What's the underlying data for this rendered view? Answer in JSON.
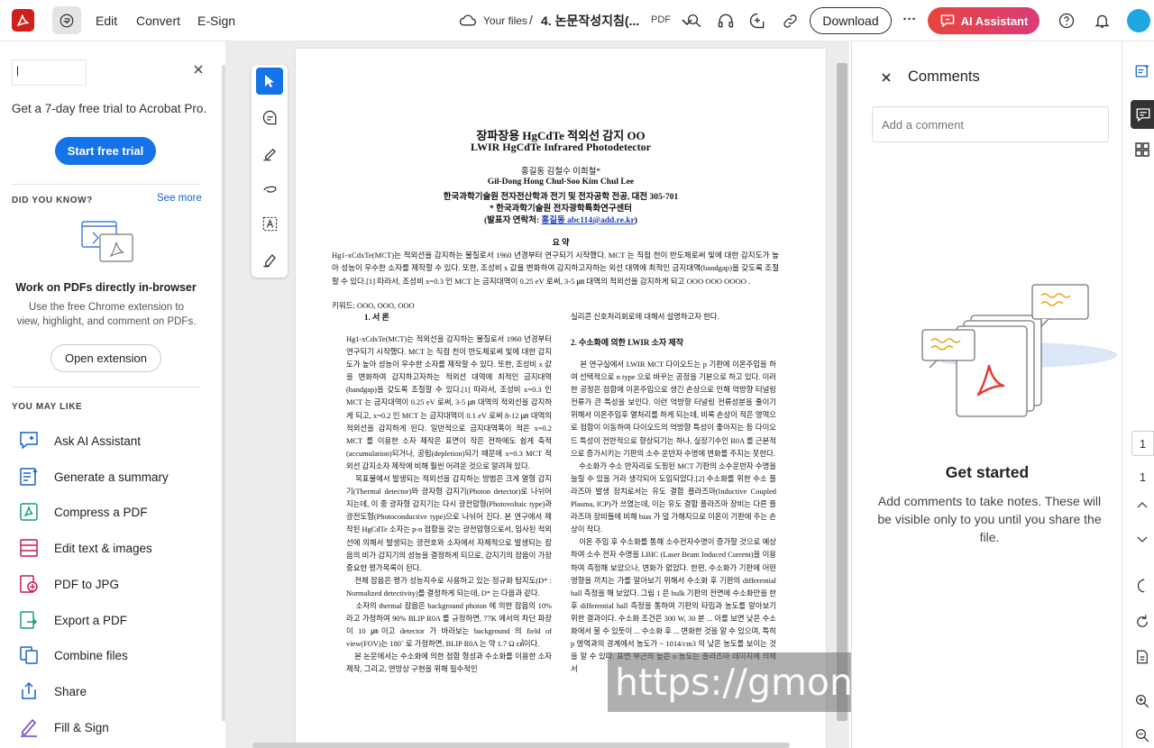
{
  "topbar": {
    "menu": [
      "Edit",
      "Convert",
      "E-Sign"
    ],
    "breadcrumb_root": "Your files",
    "breadcrumb_sep": "/",
    "doc_title": "4. 논문작성지침(...",
    "file_type": "PDF",
    "download_label": "Download",
    "more_label": "···",
    "ai_label": "AI Assistant"
  },
  "left_panel": {
    "search_value": "|",
    "trial_text": "Get a 7-day free trial to Acrobat Pro.",
    "trial_button": "Start free trial",
    "did_you_know": "DID YOU KNOW?",
    "see_more": "See more",
    "card_title": "Work on PDFs directly in-browser",
    "card_desc": "Use the free Chrome extension to view, highlight, and comment on PDFs.",
    "extension_button": "Open extension",
    "you_may_like": "YOU MAY LIKE",
    "items": [
      {
        "label": "Ask AI Assistant",
        "icon": "ai-chat-icon"
      },
      {
        "label": "Generate a summary",
        "icon": "summary-icon"
      },
      {
        "label": "Compress a PDF",
        "icon": "compress-icon"
      },
      {
        "label": "Edit text & images",
        "icon": "edit-text-icon"
      },
      {
        "label": "PDF to JPG",
        "icon": "pdf-to-jpg-icon"
      },
      {
        "label": "Export a PDF",
        "icon": "export-icon"
      },
      {
        "label": "Combine files",
        "icon": "combine-icon"
      },
      {
        "label": "Share",
        "icon": "share-icon"
      },
      {
        "label": "Fill & Sign",
        "icon": "fill-sign-icon"
      }
    ]
  },
  "document": {
    "title_kr": "장파장용 HgCdTe 적외선 감지 OO",
    "title_en": "LWIR HgCdTe Infrared Photodetector",
    "authors_kr": "홍길동   김철수  이희철*",
    "authors_en": "Gil-Dong Hong     Chul-Soo Kim    Chul Lee",
    "affil1": "한국과학기술원 전자전산학과 전기 및 전자공학 전공, 대전 305-701",
    "affil2": "*  한국과학기술원 전자광학특화연구센터",
    "contact_prefix": "(발표자 연락처: ",
    "contact_link": "홍길동  abc114@add.re.kr",
    "contact_suffix": ")",
    "abstract_heading": "요  약",
    "abstract": "Hg1-xCdxTe(MCT)는 적외선을 감지하는 물질로서 1960 년경부터 연구되기 시작했다. MCT 는 직접 천이 반도체로써 빛에 대한 감지도가 높아 성능이 우수한 소자를 제작할 수 있다. 또한, 조성비 x 값을 변화하여 감지하고자하는 외선 대역에 최적인 금지대역(bandgap)을 갖도록 조절할 수 있다.[1] 따라서, 조성비 x=0.3 인 MCT 는 금지대역이 0.25 eV 로써, 3-5 ㎛ 대역의 적외선을 감지하게 되고 OOO OOO OOOO .",
    "keywords": "키워드:  OOO,  OOO,  OOO",
    "section1": "1. 서 론",
    "col_left": "Hg1-xCdxTe(MCT)는 적외선을 감지하는 물질로서 1960 년경부터 연구되기 시작했다. MCT 는 직접 천이 반도체로써 빛에 대한 감지도가 높아 성능이 우수한 소자를 제작할 수 있다. 또한, 조성비 x 값을 변화하여 감지하고자하는 적외선 대역에 최적인 금지대역(bandgap)을 갖도록 조절할 수 있다.[1] 따라서, 조성비 x=0.3 인 MCT 는 금지대역이 0.25 eV 로써, 3-5 ㎛ 대역의 적외선을 감지하게 되고, x=0.2 인 MCT 는 금지대역이 0.1 eV 로써 8-12 ㎛ 대역의 적외선을 감지하게 된다. 일반적으로 금지대역폭이 적은 x=0.2 MCT 를 이용한 소자 제작은 표면이 작은 전하에도 쉽게 축적(accumulation)되거나, 공핍(depletion)되기 때문에 x=0.3 MCT 적외선 감지소자 제작에 비해 훨씬 어려운 것으로 알려져 있다.\n    목표물에서 발생되는 적외선을 감지하는 방법은 크게 열형 감지기(Thermal detector)와 광자형 감지기(Photon detector)로 나뉘어 지는데, 이 중 광자형 감지기는 다시 광전압형(Photovoltaic type)과 광전도형(Photoconductive type)으로 나뉘어 진다. 본 연구에서 제작된 HgCdTe 소자는 p-n 접합을 갖는 광전압형으로서, 입사된 적외선에 의해서 발생되는 광전호와 소자에서 자체적으로 발생되는 잡음의 비가 감지기의 성능을 결정하게 되므로, 감지기의 잡음이 가장 중요한 평가목록이 된다.\n    전체 잡음은 평가 성능지수로 사용하고 있는 정규화 탐지도(D* : Normalized detectivity)를 결정하게 되는데, D* 는 다음과 같다.\n    소자의 thermal 잡음은 background photon 에 의한 잡음의 10%라고 가정하여 90% BLIP R0A 를 규정하면, 77K 에서의 차단 파장이 10 ㎛이고 detector 가 바라보는 background 의 field of view(FOV)는 180˚ 로 가정하면, BLIP R0A 는 약 1.7 Ω ㎠이다.\n    본 논문에서는 수소화에 의한 접합 형성과 수소화를 이용한 소자제작, 그리고, 연방상 구현을 위해 필수적인",
    "col_right_top": "실리콘 신호처리회로에 대해서 설명하고자 한다.",
    "section2": "2. 수소화에 의한 LWIR 소자 제작",
    "col_right": "    본 연구실에서 LWIR MCT 다이오드는 p 기판에 이온주입을 하여 선택적으로 n type 으로 바꾸는 공정을 기본으로 하고 있다. 이러한 공정은 접합에 이온주입으로 생긴 손상으로 인해 억방향 터널링 전류가 큰 특성을 보인다. 이런 억방향 터널링 전류성분을 줄이기 위해서 이온주입후 열처리를 하게 되는데, 비록 손상이 적은 영역으로 접합이 이동하여 다이오드의 억방향 특성이 좋아지는 등 다이오드 특성이 전반적으로 향상되기는 하나, 실장기수인 R0A 를 근본적으로 증가시키는 기판의 소수 운반자 수명에 변화를 주지는 못한다.\n    수소화가 수소 반자리로 도핑된 MCT 기판의 소수운반자 수명을 늘릴 수 있을 거라 생각되어 도입되었다.[2] 수소화를 위한 수소 플라즈마 발생 장치로서는 유도 결합 플라즈마(Inductive Coupled Plasma, ICP)가 쓰였는데, 이는 유도 결합 플라즈마 장비는 다른 플라즈마 장비들에 비해 bias 가 덜 가해지므로 이온이 기판에 주는 손상이 작다.\n    이온 주입 후 수소화를 통해 소수전자수명이 증가할 것으로 예상하여 소수 전자 수명을 LBIC (Laser Beam Induced Current)을 이용하여 측정해 보았으나, 변화가 없었다. 한편, 수소화가 기판에 어떤 영향을 끼치는 가를 알아보기 위해서 수소화 후 기판의 differential hall 측정을 해 보았다. 그림 1 은 bulk 기판의 전면에 수소화만을 한 후 differential hall 측정을 통하여 기판의 타입과 농도를 알아보기 위한 결과이다. 수소화 조건은 300 W, 30 분 ... 이를 보면 낮은 수소화에서 불 수 있듯이 ... 수소화 후 ... 변화한 것을 알 수 있으며, 특히 p 영역과의 경계에서 농도가 ~ 1014/cm3 의 낮은 농도를 보이는 것을 알 수 있다. 표면 부근의 높은 n 농도는 플라즈마 데미지에 의해서"
  },
  "watermark": "https://gmoney.tistory.com/",
  "comments": {
    "title": "Comments",
    "placeholder": "Add a comment",
    "get_started": "Get started",
    "desc": "Add comments to take notes. These will be visible only to you until you share the file."
  },
  "rail": {
    "page_current": "1",
    "page_total": "1"
  },
  "colors": {
    "accent_blue": "#1473e6",
    "ai_gradient_start": "#e8453c",
    "ai_gradient_end": "#d93b7b",
    "adobe_red": "#d0201b",
    "icon_blue": "#1665cc"
  }
}
